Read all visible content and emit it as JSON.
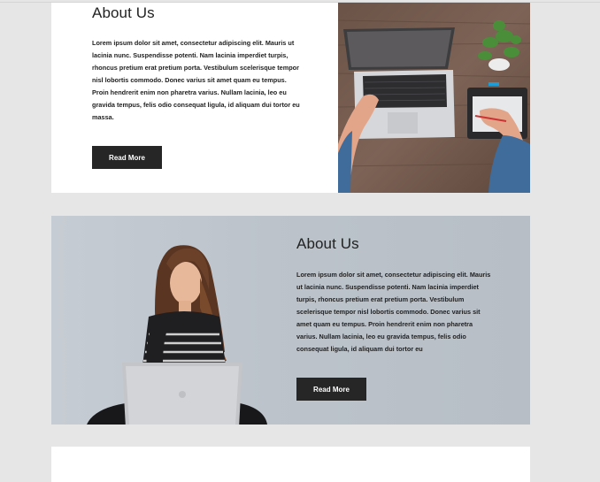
{
  "sections": [
    {
      "title": "About Us",
      "body": "Lorem ipsum dolor sit amet, consectetur adipiscing elit. Mauris ut lacinia nunc. Suspendisse potenti. Nam lacinia imperdiet turpis, rhoncus pretium erat pretium porta. Vestibulum scelerisque tempor nisl lobortis commodo. Donec varius sit amet quam eu tempus. Proin hendrerit enim non pharetra varius. Nullam lacinia, leo eu gravida tempus, felis odio consequat ligula, id aliquam dui tortor eu massa.",
      "button_label": "Read More",
      "image": "laptop-workspace-photo"
    },
    {
      "title": "About Us",
      "body": "Lorem ipsum dolor sit amet, consectetur adipiscing elit. Mauris ut lacinia nunc. Suspendisse potenti. Nam lacinia imperdiet turpis, rhoncus pretium erat pretium porta. Vestibulum scelerisque tempor nisl lobortis commodo. Donec varius sit amet quam eu tempus. Proin hendrerit enim non pharetra varius. Nullam lacinia, leo eu gravida tempus, felis odio consequat ligula, id aliquam dui tortor eu",
      "button_label": "Read More",
      "image": "woman-with-laptop-photo"
    }
  ],
  "colors": {
    "page_background": "#e6e6e6",
    "card_background": "#ffffff",
    "button_background": "#262626",
    "button_text": "#ffffff"
  }
}
